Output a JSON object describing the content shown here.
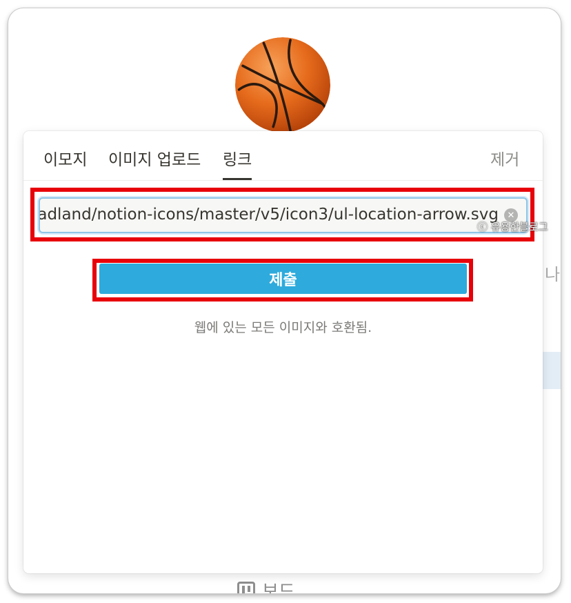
{
  "tabs": [
    {
      "label": "이모지",
      "active": false
    },
    {
      "label": "이미지 업로드",
      "active": false
    },
    {
      "label": "링크",
      "active": true
    }
  ],
  "remove_label": "제거",
  "link_input": {
    "value": "adland/notion-icons/master/v5/icon3/ul-location-arrow.svg"
  },
  "submit_label": "제출",
  "hint_text": "웹에 있는 모든 이미지와 호환됨.",
  "watermark": "ⓒ 유용한블로그",
  "background": {
    "peek_text": "나, 이",
    "board_label": "보드"
  },
  "colors": {
    "accent": "#2eaadc",
    "highlight": "#e8000a"
  },
  "icons": {
    "page_icon": "basketball-icon",
    "clear": "clear-icon",
    "board": "board-icon"
  }
}
